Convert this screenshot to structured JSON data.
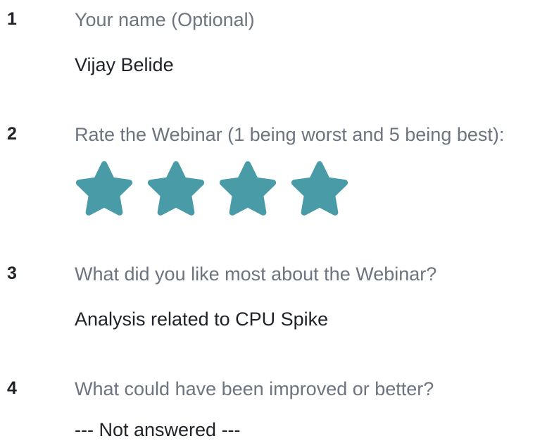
{
  "questions": [
    {
      "number": "1",
      "text": "Your name (Optional)",
      "answer": "Vijay Belide"
    },
    {
      "number": "2",
      "text": "Rate the Webinar (1 being worst and 5 being best):",
      "rating": 4,
      "rating_icon": "star-icon",
      "rating_color": "#4A9BA8"
    },
    {
      "number": "3",
      "text": "What did you like most about the Webinar?",
      "answer": "Analysis related to CPU Spike"
    },
    {
      "number": "4",
      "text": "What could have been improved or better?",
      "answer": "--- Not answered ---"
    }
  ]
}
